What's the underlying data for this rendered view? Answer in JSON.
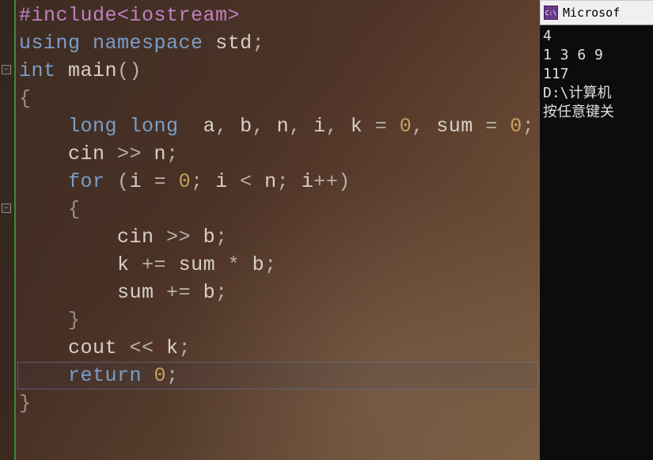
{
  "code": {
    "lines": [
      {
        "t": "preproc",
        "text": "#include<iostream>"
      },
      {
        "t": "mixed",
        "parts": [
          [
            "keyword",
            "using"
          ],
          [
            "",
            ""
          ],
          [
            "keyword",
            " namespace"
          ],
          [
            "",
            " "
          ],
          [
            "ident",
            "std"
          ],
          [
            "punct",
            ";"
          ]
        ]
      },
      {
        "t": "mixed",
        "parts": [
          [
            "type",
            "int"
          ],
          [
            "",
            " "
          ],
          [
            "ident",
            "main"
          ],
          [
            "punct",
            "()"
          ]
        ]
      },
      {
        "t": "brace",
        "text": "{"
      },
      {
        "t": "mixed",
        "indent": 1,
        "parts": [
          [
            "type",
            "long long"
          ],
          [
            "",
            "  "
          ],
          [
            "ident",
            "a"
          ],
          [
            "punct",
            ", "
          ],
          [
            "ident",
            "b"
          ],
          [
            "punct",
            ", "
          ],
          [
            "ident",
            "n"
          ],
          [
            "punct",
            ", "
          ],
          [
            "ident",
            "i"
          ],
          [
            "punct",
            ", "
          ],
          [
            "ident",
            "k"
          ],
          [
            "op",
            " = "
          ],
          [
            "num",
            "0"
          ],
          [
            "punct",
            ", "
          ],
          [
            "ident",
            "sum"
          ],
          [
            "op",
            " = "
          ],
          [
            "num",
            "0"
          ],
          [
            "punct",
            ";"
          ]
        ]
      },
      {
        "t": "mixed",
        "indent": 1,
        "parts": [
          [
            "ident",
            "cin"
          ],
          [
            "op",
            " >> "
          ],
          [
            "ident",
            "n"
          ],
          [
            "punct",
            ";"
          ]
        ]
      },
      {
        "t": "mixed",
        "indent": 1,
        "parts": [
          [
            "keyword",
            "for"
          ],
          [
            "",
            " "
          ],
          [
            "punct",
            "("
          ],
          [
            "ident",
            "i"
          ],
          [
            "op",
            " = "
          ],
          [
            "num",
            "0"
          ],
          [
            "punct",
            "; "
          ],
          [
            "ident",
            "i"
          ],
          [
            "op",
            " < "
          ],
          [
            "ident",
            "n"
          ],
          [
            "punct",
            "; "
          ],
          [
            "ident",
            "i"
          ],
          [
            "op",
            "++"
          ],
          [
            "punct",
            ")"
          ]
        ]
      },
      {
        "t": "brace",
        "indent": 1,
        "text": "{"
      },
      {
        "t": "mixed",
        "indent": 2,
        "parts": [
          [
            "ident",
            "cin"
          ],
          [
            "op",
            " >> "
          ],
          [
            "ident",
            "b"
          ],
          [
            "punct",
            ";"
          ]
        ]
      },
      {
        "t": "mixed",
        "indent": 2,
        "parts": [
          [
            "ident",
            "k"
          ],
          [
            "op",
            " += "
          ],
          [
            "ident",
            "sum"
          ],
          [
            "op",
            " * "
          ],
          [
            "ident",
            "b"
          ],
          [
            "punct",
            ";"
          ]
        ]
      },
      {
        "t": "mixed",
        "indent": 2,
        "parts": [
          [
            "ident",
            "sum"
          ],
          [
            "op",
            " += "
          ],
          [
            "ident",
            "b"
          ],
          [
            "punct",
            ";"
          ]
        ]
      },
      {
        "t": "brace",
        "indent": 1,
        "text": "}"
      },
      {
        "t": "mixed",
        "indent": 1,
        "parts": [
          [
            "ident",
            "cout"
          ],
          [
            "op",
            " << "
          ],
          [
            "ident",
            "k"
          ],
          [
            "punct",
            ";"
          ]
        ]
      },
      {
        "t": "mixed",
        "indent": 1,
        "parts": [
          [
            "keyword",
            "return"
          ],
          [
            "",
            " "
          ],
          [
            "num",
            "0"
          ],
          [
            "punct",
            ";"
          ]
        ]
      },
      {
        "t": "brace",
        "text": "}"
      }
    ],
    "fold_marks": [
      2,
      7
    ],
    "cursor_line_index": 13
  },
  "console": {
    "title": "Microsof",
    "icon_text": "C:\\",
    "output": [
      "4",
      "1 3 6 9",
      "117",
      "D:\\计算机",
      "按任意键关"
    ]
  }
}
